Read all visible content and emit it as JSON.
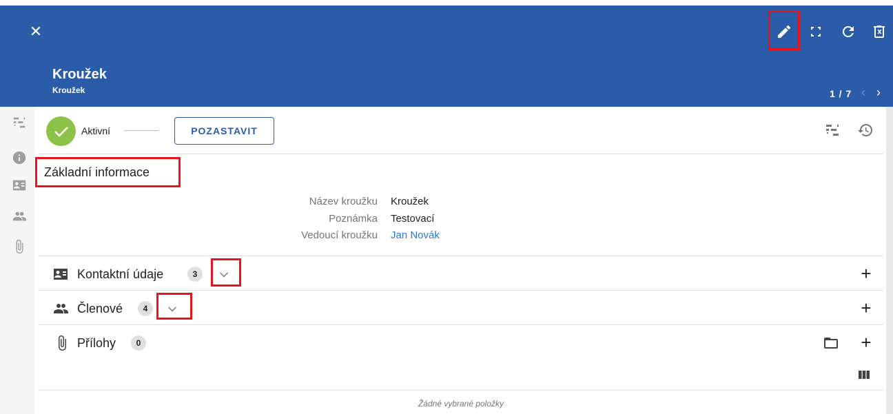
{
  "header": {
    "title": "Kroužek",
    "subtitle": "Kroužek",
    "pager": "1 / 7",
    "pager_prev": "‹",
    "pager_next": "›",
    "close_glyph": "✕",
    "colors": {
      "background": "#2a5caa",
      "highlight": "#e8141c"
    }
  },
  "status": {
    "label": "Aktivní",
    "pause_label": "POZASTAVIT",
    "color": "#8bc34a"
  },
  "basic_info": {
    "title": "Základní informace",
    "fields": [
      {
        "label": "Název kroužku",
        "value": "Kroužek"
      },
      {
        "label": "Poznámka",
        "value": "Testovací"
      },
      {
        "label": "Vedoucí kroužku",
        "value": "Jan Novák"
      }
    ]
  },
  "sections": {
    "contacts": {
      "label": "Kontaktní údaje",
      "count": "3"
    },
    "members": {
      "label": "Členové",
      "count": "4"
    },
    "attachments": {
      "label": "Přílohy",
      "count": "0",
      "empty": "Žádné vybrané položky"
    }
  },
  "icons": {
    "toolbar": [
      "pencil-icon",
      "fullscreen-icon",
      "refresh-icon",
      "delete-icon"
    ],
    "sidebar": [
      "workflow-icon",
      "info-icon",
      "contact-card-icon",
      "people-icon",
      "paperclip-icon"
    ]
  }
}
